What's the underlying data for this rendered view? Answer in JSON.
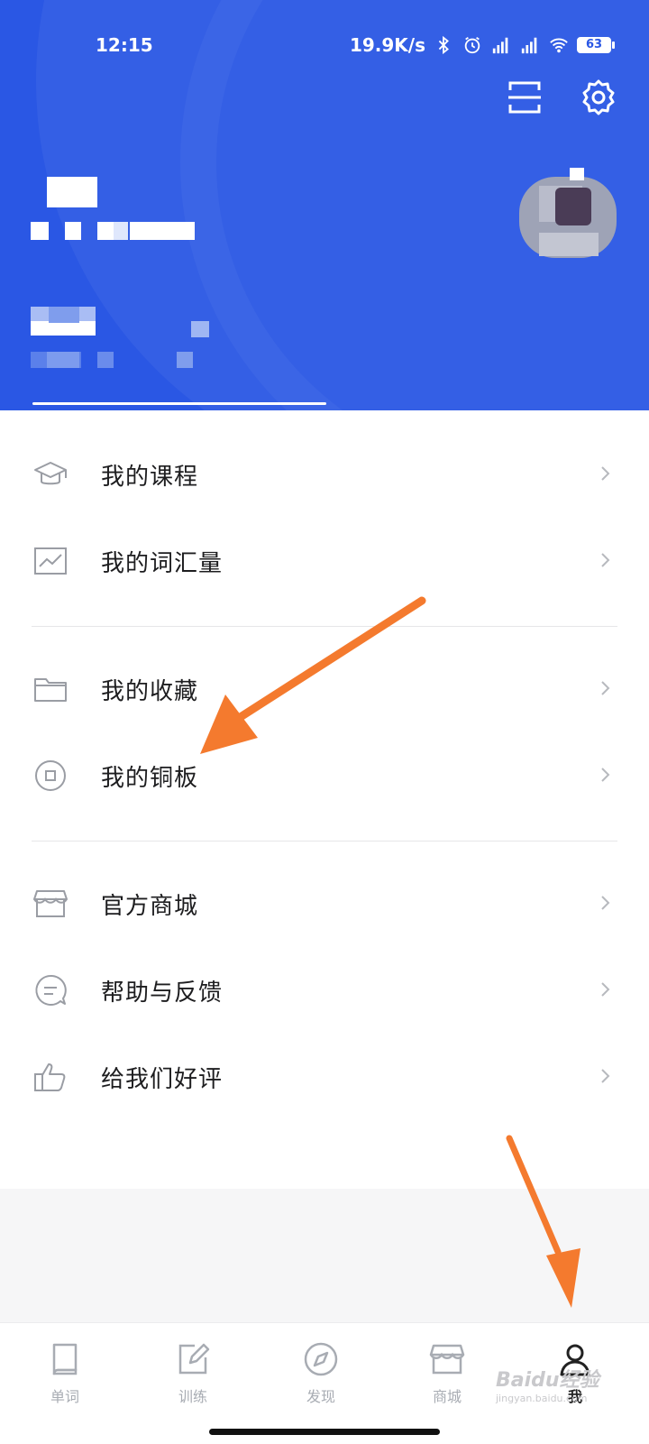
{
  "status_bar": {
    "time": "12:15",
    "net_speed": "19.9K/s",
    "battery": "63"
  },
  "header": {
    "bg_color": "#2a57e4",
    "scan_icon": "scan-icon",
    "settings_icon": "gear-icon"
  },
  "menu": {
    "groups": [
      [
        {
          "label": "我的课程",
          "icon": "graduation-cap-icon"
        },
        {
          "label": "我的词汇量",
          "icon": "chart-icon"
        }
      ],
      [
        {
          "label": "我的收藏",
          "icon": "folder-icon"
        },
        {
          "label": "我的铜板",
          "icon": "coin-icon"
        }
      ],
      [
        {
          "label": "官方商城",
          "icon": "store-icon"
        },
        {
          "label": "帮助与反馈",
          "icon": "chat-icon"
        },
        {
          "label": "给我们好评",
          "icon": "thumbs-up-icon"
        }
      ]
    ]
  },
  "tabbar": {
    "tabs": [
      {
        "label": "单词",
        "icon": "book-icon"
      },
      {
        "label": "训练",
        "icon": "edit-icon"
      },
      {
        "label": "发现",
        "icon": "compass-icon"
      },
      {
        "label": "商城",
        "icon": "store-icon"
      },
      {
        "label": "我",
        "icon": "person-icon",
        "active": true
      }
    ]
  },
  "watermark": {
    "brand": "Baidu经验",
    "url": "jingyan.baidu.com"
  },
  "colors": {
    "accent": "#2a57e4",
    "annotation_arrow": "#f47a2e",
    "text": "#1d1d1f",
    "icon_gray": "#9a9da4"
  }
}
